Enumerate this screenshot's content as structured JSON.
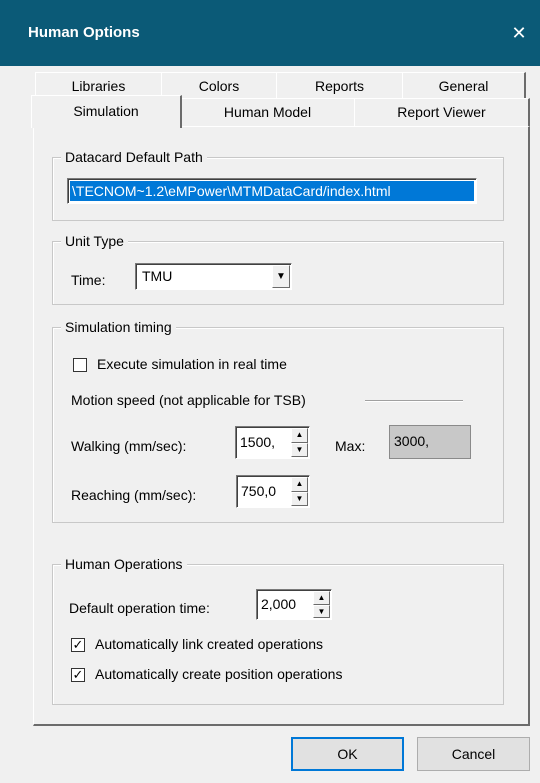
{
  "window": {
    "title": "Human Options",
    "close_glyph": "✕"
  },
  "tabs": {
    "row1": [
      "Libraries",
      "Colors",
      "Reports",
      "General"
    ],
    "row2": [
      "Simulation",
      "Human Model",
      "Report Viewer"
    ],
    "active": "Simulation"
  },
  "datacard": {
    "legend": "Datacard Default Path",
    "path_value": "\\TECNOM~1.2\\eMPower\\MTMDataCard/index.html"
  },
  "unit_type": {
    "legend": "Unit Type",
    "time_label": "Time:",
    "time_value": "TMU",
    "dropdown_glyph": "▼"
  },
  "sim_timing": {
    "legend": "Simulation timing",
    "realtime_label": "Execute simulation in real time",
    "realtime_checked": false,
    "motion_speed_label": "Motion speed (not applicable for TSB)",
    "walking_label": "Walking (mm/sec):",
    "walking_value": "1500,",
    "max_label": "Max:",
    "max_value": "3000,",
    "reaching_label": "Reaching (mm/sec):",
    "reaching_value": "750,0"
  },
  "human_ops": {
    "legend": "Human Operations",
    "default_time_label": "Default operation time:",
    "default_time_value": "2,000",
    "autolink_label": "Automatically link created operations",
    "autolink_checked": true,
    "autopos_label": "Automatically create position operations",
    "autopos_checked": true
  },
  "buttons": {
    "ok": "OK",
    "cancel": "Cancel"
  },
  "glyphs": {
    "check": "✓",
    "spin_up": "▲",
    "spin_down": "▼"
  },
  "colors": {
    "titlebar": "#0b5a77",
    "selection": "#0078d7",
    "default_button_border": "#0078d7"
  }
}
